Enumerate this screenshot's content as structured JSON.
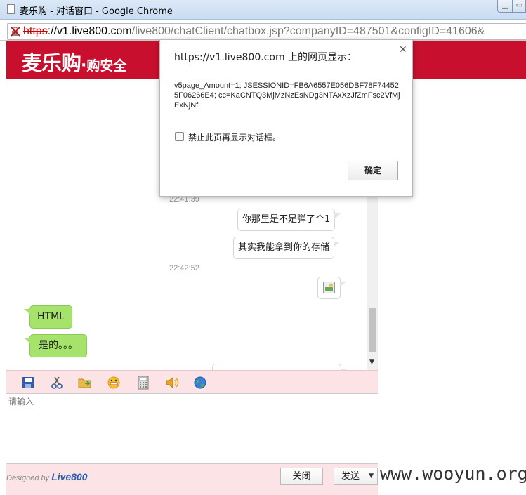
{
  "window": {
    "title": "麦乐购 - 对话窗口 - Google Chrome"
  },
  "address": {
    "scheme": "https",
    "host_part": "://v1.live800.com",
    "path_part": "/live800/chatClient/chatbox.jsp?companyID=487501&configID=41606&"
  },
  "header": {
    "logo_main": "麦乐购",
    "logo_dot": "·",
    "logo_sub": "购安全",
    "brand_color": "#c8102e"
  },
  "chat": {
    "timestamps": [
      "22:41:39",
      "22:42:52"
    ],
    "outgoing": [
      "你那里是不是弹了个1",
      "其实我能拿到你的存储"
    ],
    "incoming": [
      "HTML",
      "是的。。。"
    ]
  },
  "toolbar": {
    "icons": [
      "save-icon",
      "scissors-icon",
      "folder-icon",
      "emoticon-icon",
      "calculator-icon",
      "speaker-icon",
      "globe-icon"
    ]
  },
  "input": {
    "placeholder": "请输入"
  },
  "footer": {
    "designed_by": "Designed by",
    "brand": "Live800",
    "close_label": "关闭",
    "send_label": "发送"
  },
  "dialog": {
    "title": "https://v1.live800.com 上的网页显示：",
    "message": "v5page_Amount=1; JSESSIONID=FB6A6557E056DBF78F744525F06266E4; cc=KaCNTQ3MjMzNzEsNDg3NTAxXzJfZmFsc2VfMjExNjNf",
    "checkbox_label": "禁止此页再显示对话框。",
    "ok_label": "确定"
  },
  "watermark": "www.wooyun.org"
}
